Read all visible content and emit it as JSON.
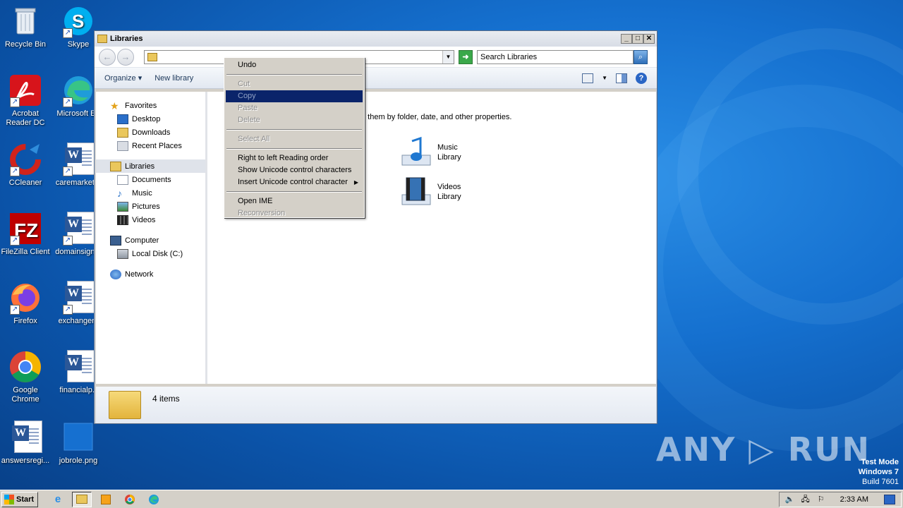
{
  "desktop": {
    "icons_col1": [
      {
        "label": "Recycle Bin",
        "icon": "recycle-bin-icon"
      },
      {
        "label": "Acrobat Reader DC",
        "icon": "acrobat-icon"
      },
      {
        "label": "CCleaner",
        "icon": "ccleaner-icon"
      },
      {
        "label": "FileZilla Client",
        "icon": "filezilla-icon"
      },
      {
        "label": "Firefox",
        "icon": "firefox-icon"
      },
      {
        "label": "Google Chrome",
        "icon": "chrome-icon"
      },
      {
        "label": "answersregi...",
        "icon": "word-doc-icon"
      }
    ],
    "icons_col2": [
      {
        "label": "Skype",
        "icon": "skype-icon"
      },
      {
        "label": "Microsoft Ed",
        "icon": "edge-icon"
      },
      {
        "label": "caremarket...",
        "icon": "word-doc-icon"
      },
      {
        "label": "domainsign...",
        "icon": "word-doc-icon"
      },
      {
        "label": "exchangem",
        "icon": "word-doc-icon"
      },
      {
        "label": "financialp.r",
        "icon": "word-doc-icon"
      },
      {
        "label": "jobrole.png",
        "icon": "image-file-icon"
      }
    ]
  },
  "window": {
    "title": "Libraries",
    "controls": {
      "minimize": "_",
      "maximize": "□",
      "close": "✕"
    },
    "search_placeholder": "Search Libraries",
    "toolbar": {
      "organize": "Organize ▾",
      "new_library": "New library"
    },
    "nav": {
      "favorites": "Favorites",
      "desktop": "Desktop",
      "downloads": "Downloads",
      "recent_places": "Recent Places",
      "libraries": "Libraries",
      "documents": "Documents",
      "music": "Music",
      "pictures": "Pictures",
      "videos": "Videos",
      "computer": "Computer",
      "local_disk": "Local Disk (C:)",
      "network": "Network"
    },
    "content": {
      "description": "e them by folder, date, and other properties.",
      "libraries": [
        {
          "name": "Music",
          "type": "Library"
        },
        {
          "name": "Videos",
          "type": "Library"
        }
      ]
    },
    "status": {
      "count": "4 items"
    }
  },
  "context_menu": {
    "items": [
      {
        "label": "Undo",
        "state": "enabled"
      },
      {
        "label": "Cut",
        "state": "disabled"
      },
      {
        "label": "Copy",
        "state": "highlighted"
      },
      {
        "label": "Paste",
        "state": "disabled"
      },
      {
        "label": "Delete",
        "state": "disabled"
      },
      {
        "label": "Select All",
        "state": "disabled"
      },
      {
        "label": "Right to left Reading order",
        "state": "enabled"
      },
      {
        "label": "Show Unicode control characters",
        "state": "enabled"
      },
      {
        "label": "Insert Unicode control character",
        "state": "enabled"
      },
      {
        "label": "Open IME",
        "state": "enabled"
      },
      {
        "label": "Reconversion",
        "state": "disabled"
      }
    ]
  },
  "watermark": {
    "brand": "ANY ▷ RUN",
    "line1": "Test Mode",
    "line2": "Windows 7",
    "line3": "Build 7601"
  },
  "taskbar": {
    "start_label": "Start",
    "clock": "2:33 AM"
  },
  "colors": {
    "menu_highlight": "#0a246a",
    "desktop_blue": "#1570cf"
  }
}
